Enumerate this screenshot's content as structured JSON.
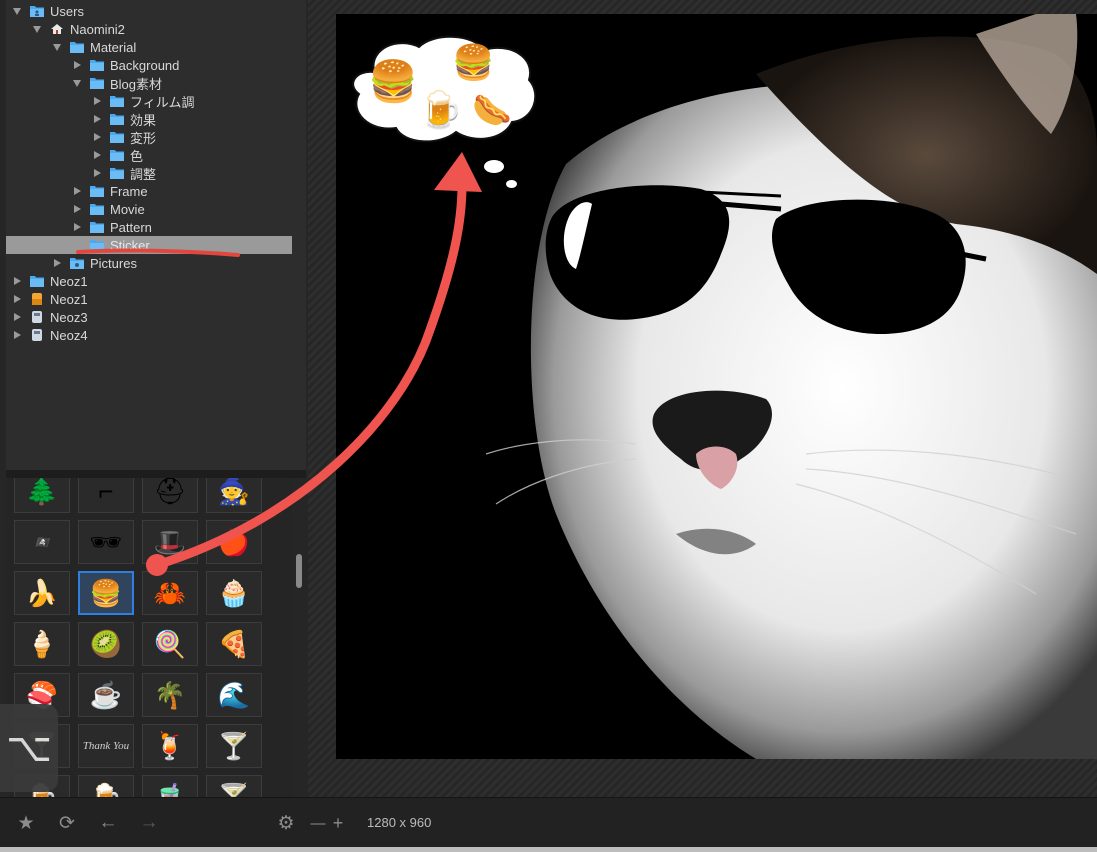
{
  "tree": {
    "items": [
      {
        "label": "Users",
        "icon": "user-folder-icon",
        "depth": 0,
        "expanded": true
      },
      {
        "label": "Naomini2",
        "icon": "home-icon",
        "depth": 1,
        "expanded": true
      },
      {
        "label": "Material",
        "icon": "folder-icon",
        "depth": 2,
        "expanded": true
      },
      {
        "label": "Background",
        "icon": "folder-icon",
        "depth": 3,
        "expanded": false
      },
      {
        "label": "Blog素材",
        "icon": "folder-icon",
        "depth": 3,
        "expanded": true
      },
      {
        "label": "フィルム調",
        "icon": "folder-icon",
        "depth": 4,
        "expanded": false
      },
      {
        "label": "効果",
        "icon": "folder-icon",
        "depth": 4,
        "expanded": false
      },
      {
        "label": "変形",
        "icon": "folder-icon",
        "depth": 4,
        "expanded": false
      },
      {
        "label": "色",
        "icon": "folder-icon",
        "depth": 4,
        "expanded": false
      },
      {
        "label": "調整",
        "icon": "folder-icon",
        "depth": 4,
        "expanded": false
      },
      {
        "label": "Frame",
        "icon": "folder-icon",
        "depth": 3,
        "expanded": false
      },
      {
        "label": "Movie",
        "icon": "folder-icon",
        "depth": 3,
        "expanded": false
      },
      {
        "label": "Pattern",
        "icon": "folder-icon",
        "depth": 3,
        "expanded": false
      },
      {
        "label": "Sticker",
        "icon": "folder-icon",
        "depth": 3,
        "expanded": false,
        "selected": true
      },
      {
        "label": "Pictures",
        "icon": "camera-folder-icon",
        "depth": 2,
        "expanded": false
      },
      {
        "label": "Neoz1",
        "icon": "folder-icon",
        "depth": 0,
        "expanded": false
      },
      {
        "label": "Neoz1",
        "icon": "drive-orange-icon",
        "depth": 0,
        "expanded": false
      },
      {
        "label": "Neoz3",
        "icon": "drive-icon",
        "depth": 0,
        "expanded": false
      },
      {
        "label": "Neoz4",
        "icon": "drive-icon",
        "depth": 0,
        "expanded": false
      }
    ]
  },
  "stickers": {
    "grid": [
      [
        "🌲",
        "⌐",
        "⛑",
        "🧙"
      ],
      [
        "🏴‍☠️",
        "🕶",
        "🎩",
        "🍎"
      ],
      [
        "🍌",
        "🍔",
        "🦀",
        "🧁"
      ],
      [
        "🍦",
        "🥝",
        "🍭",
        "🍕"
      ],
      [
        "🍣",
        "☕",
        "🌴",
        "🌊"
      ],
      [
        "🍸",
        "Thank You",
        "🍹",
        "🍸"
      ],
      [
        "🍺",
        "🍺",
        "🧋",
        "🍸"
      ]
    ],
    "selected_index": [
      2,
      1
    ]
  },
  "alt_key": {
    "glyph": "⌥"
  },
  "viewer": {
    "thought_bubble": [
      "🍔",
      "🍔",
      "🍺",
      "🌭"
    ]
  },
  "toolbar": {
    "image_size": "1280 x 960",
    "zoom_minus": "—",
    "zoom_plus": "+"
  },
  "colors": {
    "folder": "#4aa9f0",
    "selection": "#2f7fe0",
    "annotation_red": "#f0544f"
  }
}
